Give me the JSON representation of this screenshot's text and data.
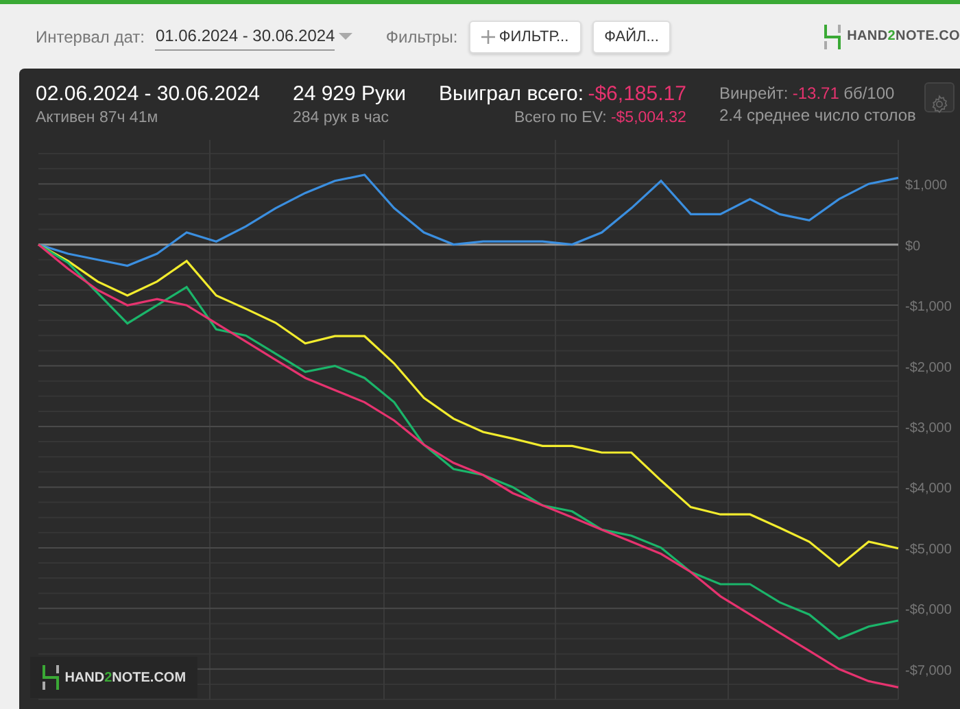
{
  "toolbar": {
    "date_label": "Интервал дат:",
    "date_range": "01.06.2024 - 30.06.2024",
    "filters_label": "Фильтры:",
    "filter_button": "ФИЛЬТР...",
    "file_button": "ФАЙЛ...",
    "logo": [
      "HAND",
      "2",
      "NOTE.CO"
    ]
  },
  "stats": {
    "period": "02.06.2024 - 30.06.2024",
    "active": "Активен 87ч 41м",
    "hands": "24 929 Руки",
    "hands_per_hour": "284 рук в час",
    "won_label": "Выиграл всего:",
    "won_value": "-$6,185.17",
    "ev_label": "Всего по EV:",
    "ev_value": "-$5,004.32",
    "winrate_label": "Винрейт:",
    "winrate_value": "-13.71",
    "winrate_unit": "бб/100",
    "tables": "2.4 среднее число столов"
  },
  "chart": {
    "watermark": [
      "HAND",
      "2",
      "NOTE.COM"
    ],
    "chart_data": {
      "type": "line",
      "grid": true,
      "ylim": [
        -7500,
        1500
      ],
      "yticks": [
        {
          "value": 1000,
          "label": "$1,000"
        },
        {
          "value": 0,
          "label": "$0"
        },
        {
          "value": -1000,
          "label": "-$1,000"
        },
        {
          "value": -2000,
          "label": "-$2,000"
        },
        {
          "value": -3000,
          "label": "-$3,000"
        },
        {
          "value": -4000,
          "label": "-$4,000"
        },
        {
          "value": -5000,
          "label": "-$5,000"
        },
        {
          "value": -6000,
          "label": "-$6,000"
        },
        {
          "value": -7000,
          "label": "-$7,000"
        }
      ],
      "series": [
        {
          "color": "#3b8fe0",
          "values": [
            0,
            -150,
            -250,
            -350,
            -150,
            200,
            50,
            300,
            600,
            850,
            1050,
            1150,
            600,
            200,
            0,
            50,
            50,
            50,
            0,
            200,
            600,
            1050,
            500,
            500,
            750,
            500,
            400,
            750,
            1000,
            1100
          ]
        },
        {
          "color": "#f2ec2e",
          "values": [
            0,
            -270,
            -610,
            -840,
            -610,
            -270,
            -840,
            -1060,
            -1290,
            -1630,
            -1510,
            -1510,
            -1960,
            -2530,
            -2870,
            -3090,
            -3200,
            -3320,
            -3320,
            -3430,
            -3430,
            -3890,
            -4330,
            -4450,
            -4450,
            -4670,
            -4900,
            -5300,
            -4900,
            -5010
          ]
        },
        {
          "color": "#1bb56a",
          "values": [
            0,
            -300,
            -800,
            -1300,
            -1000,
            -700,
            -1400,
            -1500,
            -1800,
            -2100,
            -2000,
            -2200,
            -2600,
            -3300,
            -3700,
            -3800,
            -4000,
            -4300,
            -4400,
            -4700,
            -4800,
            -5000,
            -5400,
            -5600,
            -5600,
            -5900,
            -6100,
            -6500,
            -6300,
            -6200
          ]
        },
        {
          "color": "#e6336f",
          "values": [
            0,
            -400,
            -750,
            -1000,
            -900,
            -1000,
            -1300,
            -1600,
            -1900,
            -2200,
            -2400,
            -2600,
            -2900,
            -3300,
            -3600,
            -3800,
            -4100,
            -4300,
            -4500,
            -4700,
            -4900,
            -5100,
            -5400,
            -5800,
            -6100,
            -6400,
            -6700,
            -7000,
            -7200,
            -7300
          ]
        }
      ]
    }
  }
}
